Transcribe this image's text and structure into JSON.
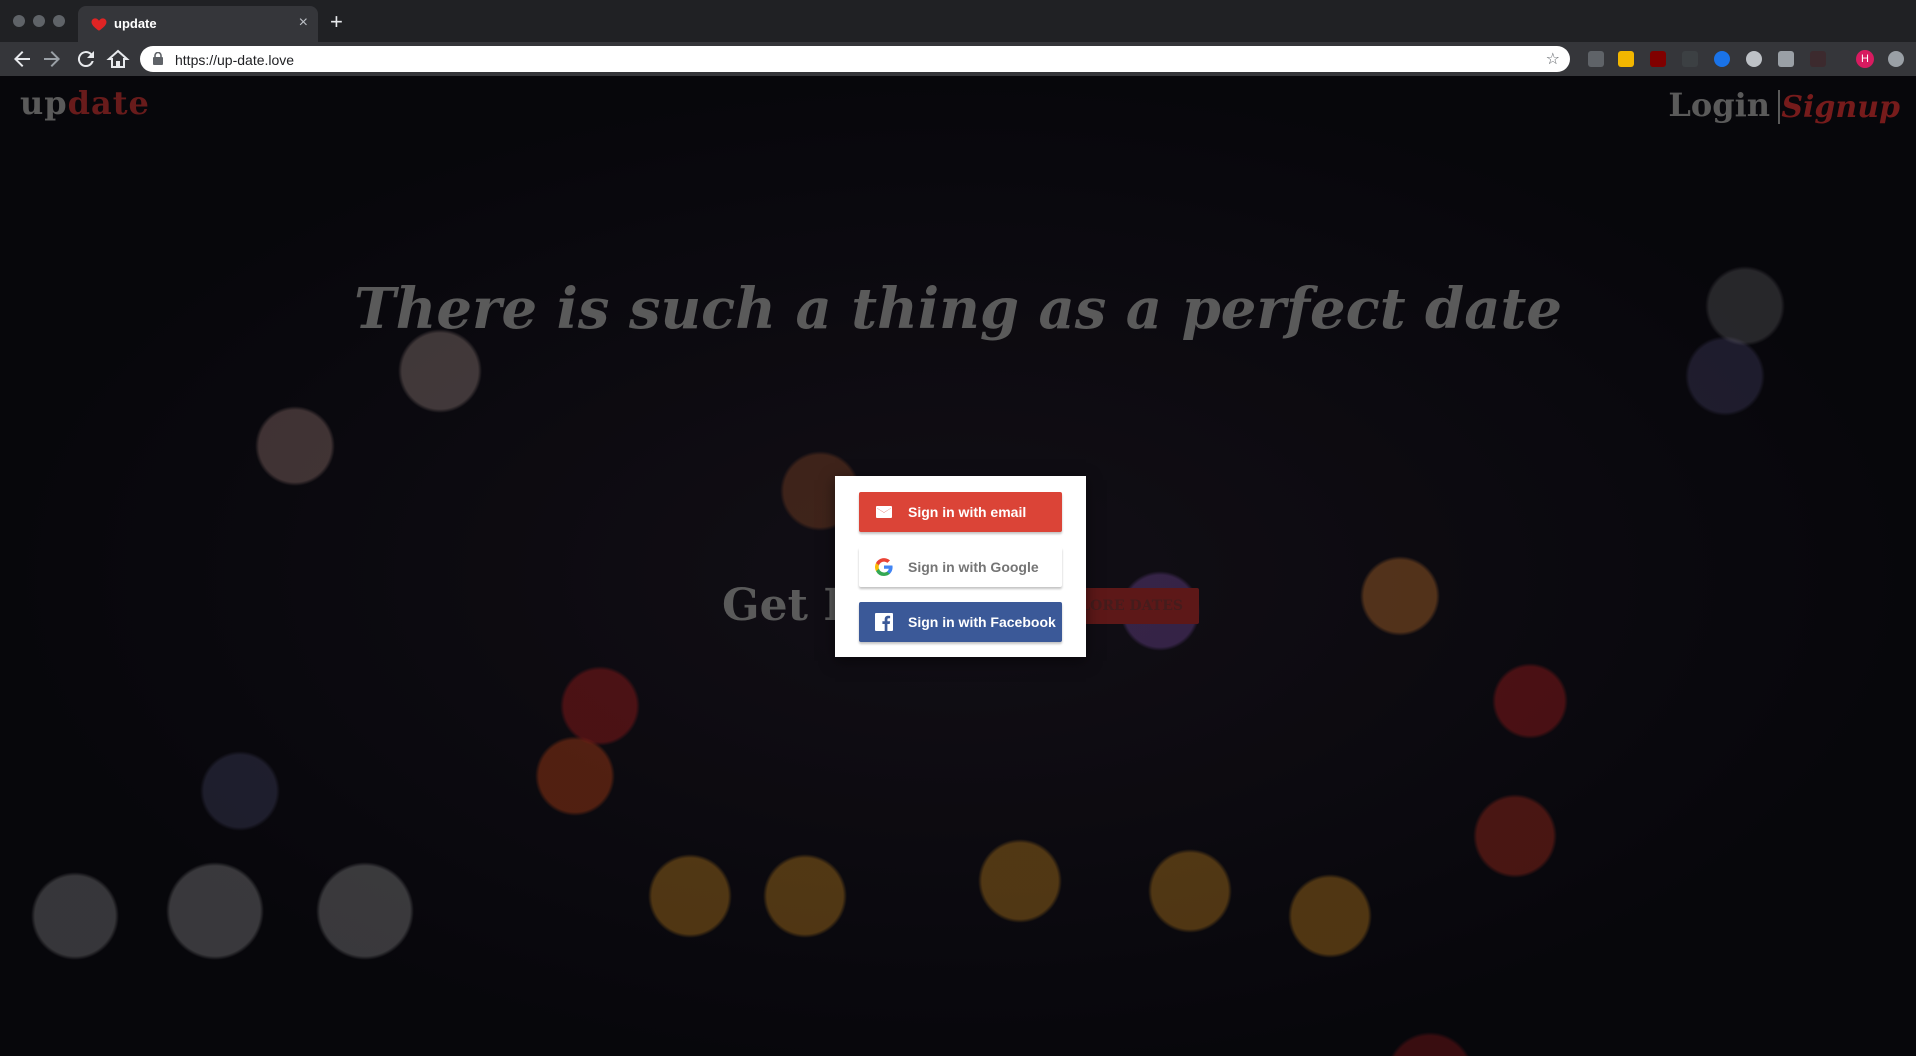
{
  "browser": {
    "tab_title": "update",
    "tab_close": "×",
    "new_tab": "+",
    "url": "https://up-date.love",
    "favicon": "heart-icon",
    "profile_initial": "H"
  },
  "header": {
    "brand_part1": "up",
    "brand_part2": "date",
    "login": "Login",
    "signup": "Signup"
  },
  "hero": {
    "headline": "There is such a thing as a perfect date",
    "cta_text": "Get I",
    "explore_button": "PLORE DATES"
  },
  "auth_modal": {
    "email_button": "Sign in with email",
    "google_button": "Sign in with Google",
    "facebook_button": "Sign in with Facebook"
  },
  "colors": {
    "email_red": "#db4437",
    "facebook_blue": "#3b5998",
    "brand_red": "#a02a2a"
  }
}
